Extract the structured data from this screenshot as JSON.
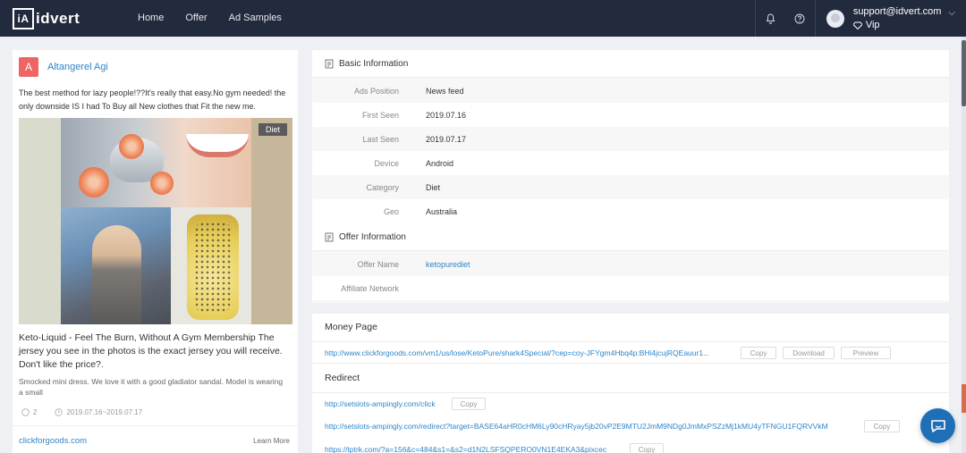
{
  "header": {
    "logo_text": "idvert",
    "logo_mark": "iA",
    "nav": [
      "Home",
      "Offer",
      "Ad Samples"
    ],
    "user_email": "support@idvert.com",
    "user_tier": "Vip"
  },
  "ad": {
    "advertiser_initial": "A",
    "advertiser_name": "Altangerel Agi",
    "text": "The best method for lazy people!??It's really that easy.No gym needed! the only downside IS I had To Buy all New clothes that Fit the new me.",
    "tag": "Diet",
    "title": "Keto-Liquid - Feel The Burn, Without A Gym Membership The jersey you see in the photos is the exact jersey you will receive. Don't like the price?.",
    "description": "Smocked mini dress. We love it with a good gladiator sandal. Model is wearing a small",
    "comments": "2",
    "date_range": "2019.07.16~2019.07.17",
    "domain": "clickforgoods.com",
    "learn_more": "Learn More"
  },
  "basic_info": {
    "title": "Basic Information",
    "rows": [
      {
        "label": "Ads Position",
        "value": "News feed"
      },
      {
        "label": "First Seen",
        "value": "2019.07.16"
      },
      {
        "label": "Last Seen",
        "value": "2019.07.17"
      },
      {
        "label": "Device",
        "value": "Android"
      },
      {
        "label": "Category",
        "value": "Diet"
      },
      {
        "label": "Geo",
        "value": "Australia"
      }
    ]
  },
  "offer_info": {
    "title": "Offer Information",
    "rows": [
      {
        "label": "Offer Name",
        "value": "ketopurediet"
      },
      {
        "label": "Affiliate Network",
        "value": ""
      }
    ]
  },
  "money_page": {
    "title": "Money Page",
    "url": "http://www.clickforgoods.com/vm1/us/lose/KetoPure/shark4Special/?cep=coy-JFYgm4Hbq4p:BHi4jcujRQEauur1...",
    "copy": "Copy",
    "download": "Download",
    "preview": "Preview"
  },
  "redirect": {
    "title": "Redirect",
    "urls": [
      {
        "url": "http://setslots-ampingly.com/click",
        "copy": "Copy"
      },
      {
        "url": "http://setslots-ampingly.com/redirect?target=BASE64aHR0cHM6Ly90cHRyay5jb20vP2E9MTU2JmM9NDg0JmMxPSZzMj1kMU4yTFNGU1FQRVVkM",
        "copy": "Copy"
      },
      {
        "url": "https://tptrk.com/?a=156&c=484&s1=&s2=d1N2LSFSQPERO0VN1E4EKA3&pixcec",
        "copy": "Copy"
      }
    ]
  }
}
